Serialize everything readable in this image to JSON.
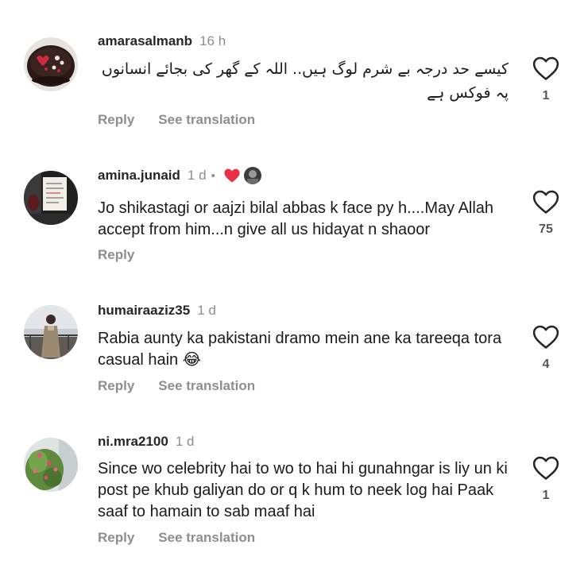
{
  "comments": [
    {
      "username": "amarasalmanb",
      "time": "16 h",
      "text": "کیسے حد درجہ بے شرم لوگ ہیں.. اللہ کے گھر کی بجائے انسانوں پہ فوکس ہے",
      "likes": "1",
      "reply_label": "Reply",
      "translate_label": "See translation",
      "avatar": "cake-photo-avatar"
    },
    {
      "username": "amina.junaid",
      "time": "1 d",
      "separator": "•",
      "author_reaction": "red-heart-icon",
      "text": "Jo shikastagi or aajzi bilal abbas k face py h....May Allah accept from him...n give all us hidayat n shaoor",
      "likes": "75",
      "reply_label": "Reply",
      "avatar": "handwritten-sign-photo-avatar"
    },
    {
      "username": "humairaaziz35",
      "time": "1 d",
      "text": "Rabia aunty ka pakistani dramo mein ane ka tareeqa tora casual hain 😂",
      "likes": "4",
      "reply_label": "Reply",
      "translate_label": "See translation",
      "avatar": "woman-standing-photo-avatar"
    },
    {
      "username": "ni.mra2100",
      "time": "1 d",
      "text": "Since wo celebrity hai to wo to hai hi gunahngar is liy un ki post pe khub galiyan do or q k hum to neek log hai Paak saaf to hamain to sab maaf hai",
      "likes": "1",
      "reply_label": "Reply",
      "translate_label": "See translation",
      "avatar": "flowers-photo-avatar"
    }
  ],
  "colors": {
    "text": "#262626",
    "secondary": "#8e8e8e",
    "heart_red": "#ed2f45"
  }
}
